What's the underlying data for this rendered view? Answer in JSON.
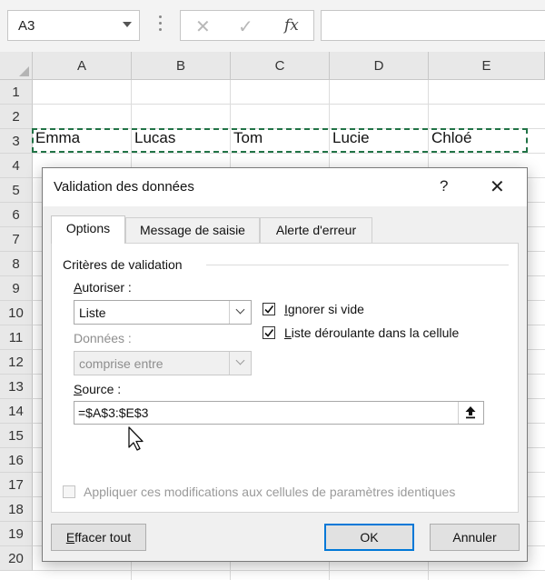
{
  "namebox": {
    "value": "A3"
  },
  "formula_bar": {
    "cancel_glyph": "✕",
    "enter_glyph": "✓",
    "fx_label": "fx",
    "value": ""
  },
  "columns": [
    "A",
    "B",
    "C",
    "D",
    "E"
  ],
  "rows": [
    "1",
    "2",
    "3",
    "4",
    "5",
    "6",
    "7",
    "8",
    "9",
    "10",
    "11",
    "12",
    "13",
    "14",
    "15",
    "16",
    "17",
    "18",
    "19",
    "20"
  ],
  "cells": {
    "A3": "Emma",
    "B3": "Lucas",
    "C3": "Tom",
    "D3": "Lucie",
    "E3": "Chloé"
  },
  "dialog": {
    "title": "Validation des données",
    "help": "?",
    "close": "✕",
    "tabs": [
      {
        "label": "Options",
        "active": true
      },
      {
        "label": "Message de saisie",
        "active": false
      },
      {
        "label": "Alerte d'erreur",
        "active": false
      }
    ],
    "criteria_title": "Critères de validation",
    "allow": {
      "label_accel": "A",
      "label_rest": "utoriser :",
      "value": "Liste"
    },
    "data": {
      "label": "Données :",
      "value": "comprise entre"
    },
    "ignore_blank": {
      "label_accel": "I",
      "label_rest": "gnorer si vide",
      "checked": true
    },
    "in_cell_dropdown": {
      "label_accel": "L",
      "label_rest": "iste déroulante dans la cellule",
      "checked": true
    },
    "source": {
      "label_accel": "S",
      "label_rest": "ource :",
      "value": "=$A$3:$E$3"
    },
    "apply_all": {
      "label": "Appliquer ces modifications aux cellules de paramètres identiques",
      "checked": false,
      "enabled": false
    },
    "buttons": {
      "clear_accel": "E",
      "clear_rest": "ffacer tout",
      "ok": "OK",
      "cancel": "Annuler"
    }
  },
  "colors": {
    "accent": "#0078d7",
    "selection": "#217346"
  }
}
